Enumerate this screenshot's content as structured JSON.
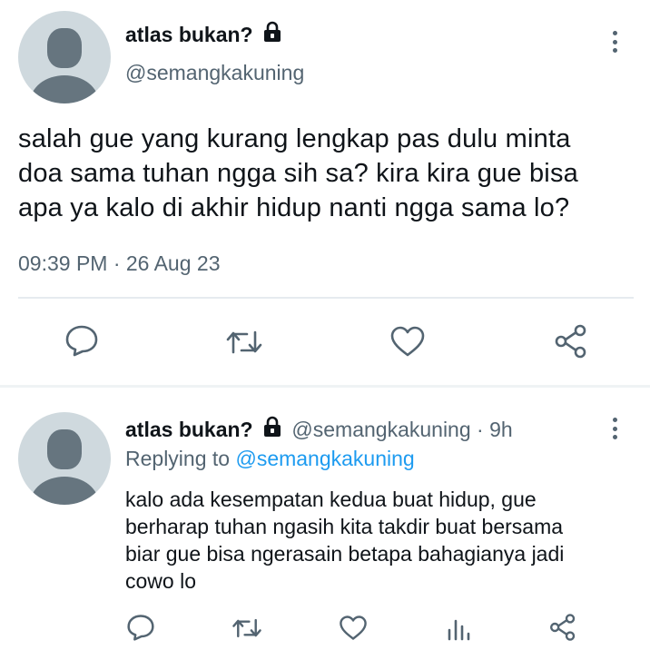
{
  "main_tweet": {
    "display_name": "atlas bukan?",
    "handle": "@semangkakuning",
    "lines": [
      "salah gue yang kurang lengkap pas dulu minta",
      "doa sama tuhan ngga sih sa? kira kira gue bisa",
      "apa ya kalo di akhir hidup nanti ngga sama lo?"
    ],
    "timestamp": "09:39 PM · 26 Aug 23",
    "icons": {
      "more": "more-vertical-icon",
      "actions": [
        "reply-icon",
        "retweet-icon",
        "like-icon",
        "share-icon"
      ],
      "protected": "lock-icon"
    }
  },
  "reply_tweet": {
    "display_name": "atlas bukan?",
    "handle_time": "@semangkakuning · 9h",
    "replying_prefix": "Replying to",
    "replying_handle": "@semangkakuning",
    "lines": [
      "kalo ada kesempatan kedua buat hidup, gue",
      "berharap tuhan ngasih kita takdir buat bersama",
      "biar gue bisa ngerasain betapa bahagianya jadi",
      "cowo lo"
    ],
    "icons": {
      "more": "more-vertical-icon",
      "actions": [
        "reply-icon",
        "retweet-icon",
        "like-icon",
        "analytics-icon",
        "share-icon"
      ],
      "protected": "lock-icon"
    }
  },
  "colors": {
    "text": "#0f1419",
    "muted": "#536471",
    "link": "#1d9bf0",
    "icon": "#536471",
    "avatar_bg": "#cfd9de",
    "avatar_fg": "#66757f",
    "divider": "#e6ebef"
  }
}
